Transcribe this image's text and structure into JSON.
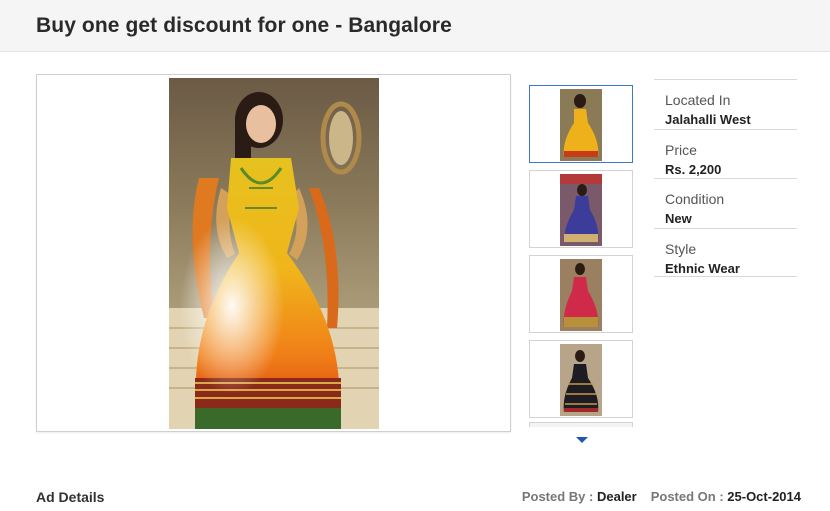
{
  "header": {
    "title": "Buy one get discount for one - Bangalore"
  },
  "gallery": {
    "thumbnails": [
      {
        "name": "thumb-yellow-anarkali",
        "selected": true
      },
      {
        "name": "thumb-blue-lehenga",
        "selected": false
      },
      {
        "name": "thumb-red-lehenga",
        "selected": false
      },
      {
        "name": "thumb-black-anarkali",
        "selected": false
      }
    ]
  },
  "details": {
    "located_in_label": "Located In",
    "located_in_value": "Jalahalli West",
    "price_label": "Price",
    "price_value": "Rs. 2,200",
    "condition_label": "Condition",
    "condition_value": "New",
    "style_label": "Style",
    "style_value": "Ethnic Wear"
  },
  "footer": {
    "ad_details_label": "Ad Details",
    "posted_by_label": "Posted By : ",
    "posted_by_value": "Dealer",
    "posted_on_label": "Posted On : ",
    "posted_on_value": "25-Oct-2014"
  },
  "colors": {
    "accent": "#3a78c9",
    "arrow": "#1f57b0"
  }
}
